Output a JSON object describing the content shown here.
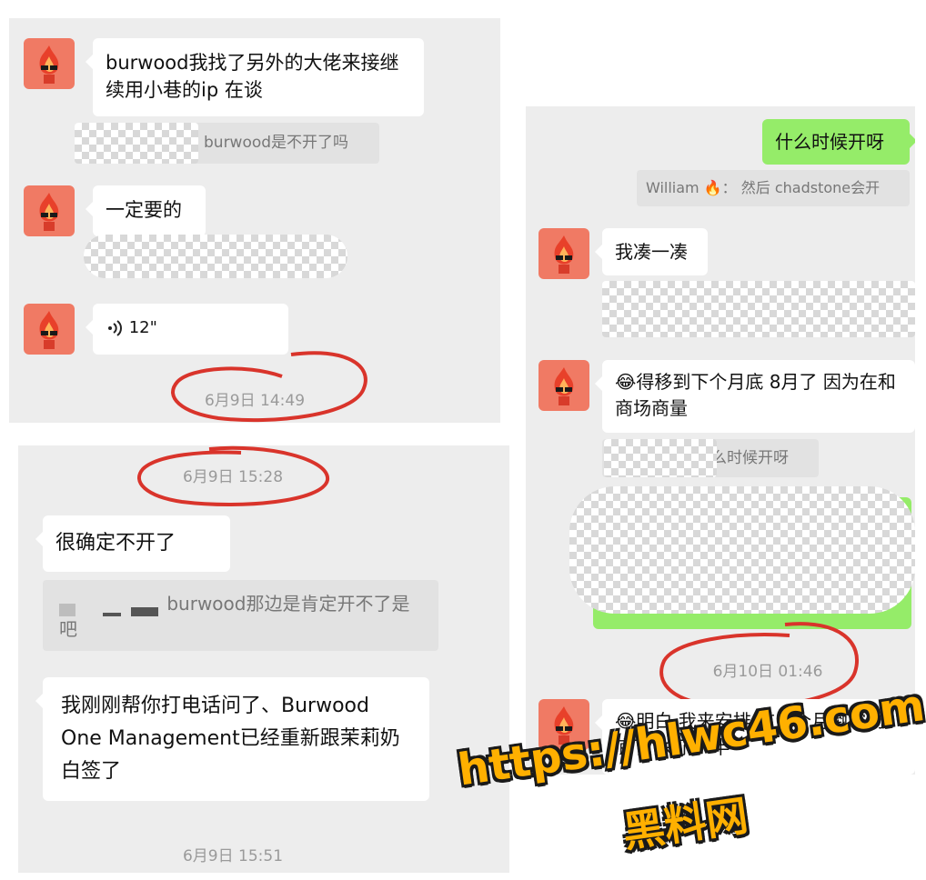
{
  "panel1": {
    "msg1": "burwood我找了另外的大佬来接继续用小巷的ip 在谈",
    "quote1": "burwood是不开了吗",
    "msg2": "一定要的",
    "voice_duration": "12\"",
    "time": "6月9日 14:49"
  },
  "panel2": {
    "time_top": "6月9日 15:28",
    "msg1": "很确定不开了",
    "quote1": "burwood那边是肯定开不了是吧",
    "msg2": "我刚刚帮你打电话问了、Burwood One Management已经重新跟茉莉奶白签了",
    "time_bottom": "6月9日 15:51"
  },
  "panel3": {
    "sent1": "什么时候开呀",
    "quote1_user": "William",
    "quote1_text": "然后 chadstone会开",
    "msg1": "我凑一凑",
    "msg2": "得移到下个月底 8月了 因为在和商场商量",
    "quote2": "么时候开呀",
    "time": "6月10日 01:46",
    "msg3": "明白 我来安排 这五个月倒霉到底了 关了一半"
  },
  "watermark": {
    "url": "https://hlwc46.com",
    "site": "黑料网"
  },
  "icons": {
    "avatar": "flame-avatar-icon",
    "voice": "voice-wave-icon",
    "fire": "fire-emoji-icon",
    "laugh": "laugh-emoji-icon"
  },
  "colors": {
    "annotation_circle": "#d9342b",
    "sent_bubble": "#95ec69",
    "watermark_text": "#ffb000"
  }
}
